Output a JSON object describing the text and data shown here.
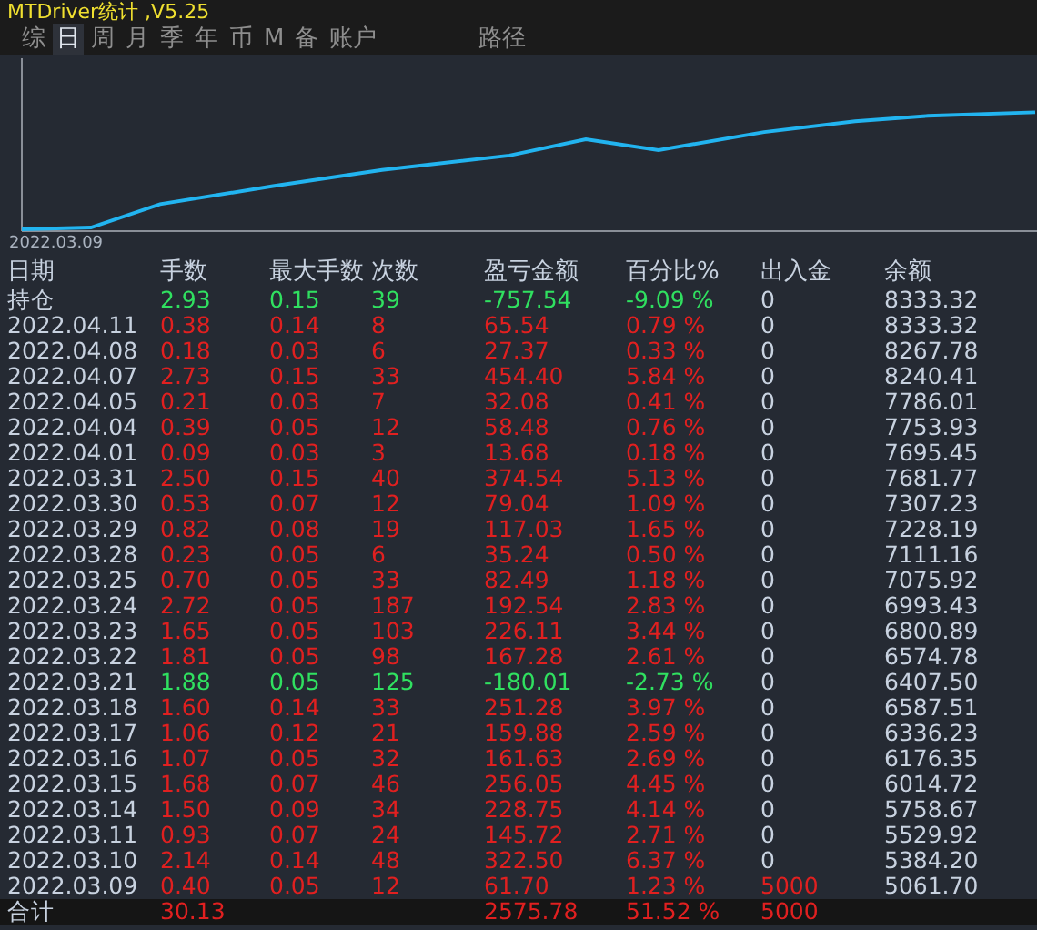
{
  "window": {
    "title": "MTDriver统计 ,V5.25"
  },
  "tabs": [
    {
      "label": "综",
      "selected": false
    },
    {
      "label": "日",
      "selected": true
    },
    {
      "label": "周",
      "selected": false
    },
    {
      "label": "月",
      "selected": false
    },
    {
      "label": "季",
      "selected": false
    },
    {
      "label": "年",
      "selected": false
    },
    {
      "label": "币",
      "selected": false
    },
    {
      "label": "M",
      "selected": false
    },
    {
      "label": "备",
      "selected": false
    },
    {
      "label": "账户",
      "selected": false
    },
    {
      "label": "路径",
      "selected": false
    }
  ],
  "chart": {
    "start_label": "2022.03.09"
  },
  "table": {
    "columns": [
      "日期",
      "手数",
      "最大手数",
      "次数",
      "盈亏金额",
      "百分比%",
      "出入金",
      "余额"
    ],
    "rows": [
      {
        "kind": "loss",
        "deposit_highlighted": false,
        "cells": [
          "持仓",
          "2.93",
          "0.15",
          "39",
          "-757.54",
          "-9.09 %",
          "0",
          "8333.32"
        ]
      },
      {
        "kind": "gain",
        "deposit_highlighted": false,
        "cells": [
          "2022.04.11",
          "0.38",
          "0.14",
          "8",
          "65.54",
          "0.79 %",
          "0",
          "8333.32"
        ]
      },
      {
        "kind": "gain",
        "deposit_highlighted": false,
        "cells": [
          "2022.04.08",
          "0.18",
          "0.03",
          "6",
          "27.37",
          "0.33 %",
          "0",
          "8267.78"
        ]
      },
      {
        "kind": "gain",
        "deposit_highlighted": false,
        "cells": [
          "2022.04.07",
          "2.73",
          "0.15",
          "33",
          "454.40",
          "5.84 %",
          "0",
          "8240.41"
        ]
      },
      {
        "kind": "gain",
        "deposit_highlighted": false,
        "cells": [
          "2022.04.05",
          "0.21",
          "0.03",
          "7",
          "32.08",
          "0.41 %",
          "0",
          "7786.01"
        ]
      },
      {
        "kind": "gain",
        "deposit_highlighted": false,
        "cells": [
          "2022.04.04",
          "0.39",
          "0.05",
          "12",
          "58.48",
          "0.76 %",
          "0",
          "7753.93"
        ]
      },
      {
        "kind": "gain",
        "deposit_highlighted": false,
        "cells": [
          "2022.04.01",
          "0.09",
          "0.03",
          "3",
          "13.68",
          "0.18 %",
          "0",
          "7695.45"
        ]
      },
      {
        "kind": "gain",
        "deposit_highlighted": false,
        "cells": [
          "2022.03.31",
          "2.50",
          "0.15",
          "40",
          "374.54",
          "5.13 %",
          "0",
          "7681.77"
        ]
      },
      {
        "kind": "gain",
        "deposit_highlighted": false,
        "cells": [
          "2022.03.30",
          "0.53",
          "0.07",
          "12",
          "79.04",
          "1.09 %",
          "0",
          "7307.23"
        ]
      },
      {
        "kind": "gain",
        "deposit_highlighted": false,
        "cells": [
          "2022.03.29",
          "0.82",
          "0.08",
          "19",
          "117.03",
          "1.65 %",
          "0",
          "7228.19"
        ]
      },
      {
        "kind": "gain",
        "deposit_highlighted": false,
        "cells": [
          "2022.03.28",
          "0.23",
          "0.05",
          "6",
          "35.24",
          "0.50 %",
          "0",
          "7111.16"
        ]
      },
      {
        "kind": "gain",
        "deposit_highlighted": false,
        "cells": [
          "2022.03.25",
          "0.70",
          "0.05",
          "33",
          "82.49",
          "1.18 %",
          "0",
          "7075.92"
        ]
      },
      {
        "kind": "gain",
        "deposit_highlighted": false,
        "cells": [
          "2022.03.24",
          "2.72",
          "0.05",
          "187",
          "192.54",
          "2.83 %",
          "0",
          "6993.43"
        ]
      },
      {
        "kind": "gain",
        "deposit_highlighted": false,
        "cells": [
          "2022.03.23",
          "1.65",
          "0.05",
          "103",
          "226.11",
          "3.44 %",
          "0",
          "6800.89"
        ]
      },
      {
        "kind": "gain",
        "deposit_highlighted": false,
        "cells": [
          "2022.03.22",
          "1.81",
          "0.05",
          "98",
          "167.28",
          "2.61 %",
          "0",
          "6574.78"
        ]
      },
      {
        "kind": "loss",
        "deposit_highlighted": false,
        "cells": [
          "2022.03.21",
          "1.88",
          "0.05",
          "125",
          "-180.01",
          "-2.73 %",
          "0",
          "6407.50"
        ]
      },
      {
        "kind": "gain",
        "deposit_highlighted": false,
        "cells": [
          "2022.03.18",
          "1.60",
          "0.14",
          "33",
          "251.28",
          "3.97 %",
          "0",
          "6587.51"
        ]
      },
      {
        "kind": "gain",
        "deposit_highlighted": false,
        "cells": [
          "2022.03.17",
          "1.06",
          "0.12",
          "21",
          "159.88",
          "2.59 %",
          "0",
          "6336.23"
        ]
      },
      {
        "kind": "gain",
        "deposit_highlighted": false,
        "cells": [
          "2022.03.16",
          "1.07",
          "0.05",
          "32",
          "161.63",
          "2.69 %",
          "0",
          "6176.35"
        ]
      },
      {
        "kind": "gain",
        "deposit_highlighted": false,
        "cells": [
          "2022.03.15",
          "1.68",
          "0.07",
          "46",
          "256.05",
          "4.45 %",
          "0",
          "6014.72"
        ]
      },
      {
        "kind": "gain",
        "deposit_highlighted": false,
        "cells": [
          "2022.03.14",
          "1.50",
          "0.09",
          "34",
          "228.75",
          "4.14 %",
          "0",
          "5758.67"
        ]
      },
      {
        "kind": "gain",
        "deposit_highlighted": false,
        "cells": [
          "2022.03.11",
          "0.93",
          "0.07",
          "24",
          "145.72",
          "2.71 %",
          "0",
          "5529.92"
        ]
      },
      {
        "kind": "gain",
        "deposit_highlighted": false,
        "cells": [
          "2022.03.10",
          "2.14",
          "0.14",
          "48",
          "322.50",
          "6.37 %",
          "0",
          "5384.20"
        ]
      },
      {
        "kind": "gain",
        "deposit_highlighted": true,
        "cells": [
          "2022.03.09",
          "0.40",
          "0.05",
          "12",
          "61.70",
          "1.23 %",
          "5000",
          "5061.70"
        ]
      }
    ],
    "total": {
      "label": "合计",
      "lots": "30.13",
      "profit": "2575.78",
      "percent": "51.52 %",
      "deposit": "5000"
    }
  }
}
